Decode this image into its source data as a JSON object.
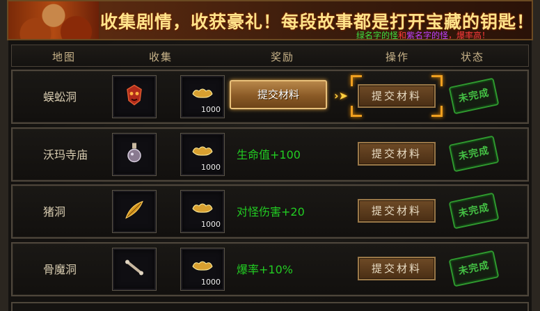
{
  "banner": {
    "title": "收集剧情，收获豪礼！每段故事都是打开宝藏的钥匙！",
    "sub_part1": "绿名字的怪",
    "sub_part2": "和",
    "sub_part3": "紫名字的怪",
    "sub_part4": "，爆率高！"
  },
  "header": {
    "map": "地图",
    "collect": "收集",
    "reward": "奖励",
    "operation": "操作",
    "status": "状态"
  },
  "rows": [
    {
      "map": "蜈蚣洞",
      "item_icon": "red-mask-icon",
      "material_qty": "1000",
      "reward": "",
      "reward_button": "提交材料",
      "operation": "提交材料",
      "status": "未完成",
      "highlighted": true
    },
    {
      "map": "沃玛寺庙",
      "item_icon": "potion-flask-icon",
      "material_qty": "1000",
      "reward": "生命值+100",
      "operation": "提交材料",
      "status": "未完成"
    },
    {
      "map": "猪洞",
      "item_icon": "golden-feather-icon",
      "material_qty": "1000",
      "reward": "对怪伤害+20",
      "operation": "提交材料",
      "status": "未完成"
    },
    {
      "map": "骨魔洞",
      "item_icon": "bone-icon",
      "material_qty": "1000",
      "reward": "爆率+10%",
      "operation": "提交材料",
      "status": "未完成"
    }
  ],
  "colors": {
    "reward_green": "#22cc22",
    "stamp_green": "#44c044",
    "highlight_orange": "#f0a020"
  }
}
